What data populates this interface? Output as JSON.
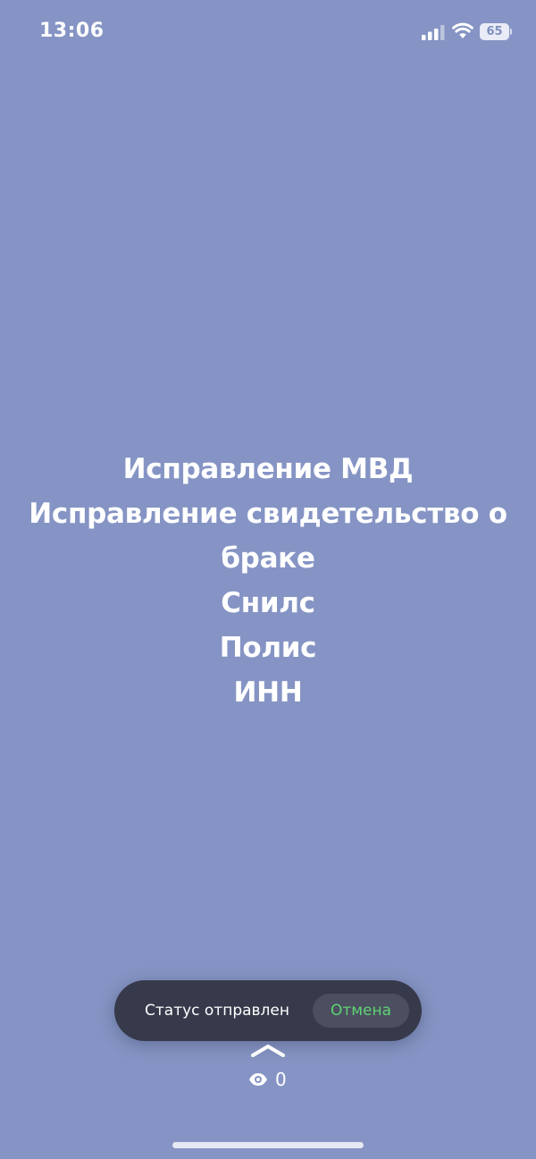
{
  "status_bar": {
    "time": "13:06",
    "battery_level": "65",
    "icons": [
      "signal-icon",
      "wifi-icon",
      "battery-icon"
    ]
  },
  "story": {
    "lines": [
      "Исправление МВД",
      "Исправление свидетельство о",
      "браке",
      "Снилс",
      "Полис",
      "ИНН"
    ],
    "background_color": "#8594c4"
  },
  "toast": {
    "message": "Статус отправлен",
    "undo_label": "Отмена",
    "undo_color": "#5fd373"
  },
  "footer": {
    "views_count": "0",
    "icons": [
      "chevron-up-icon",
      "eye-icon"
    ]
  }
}
